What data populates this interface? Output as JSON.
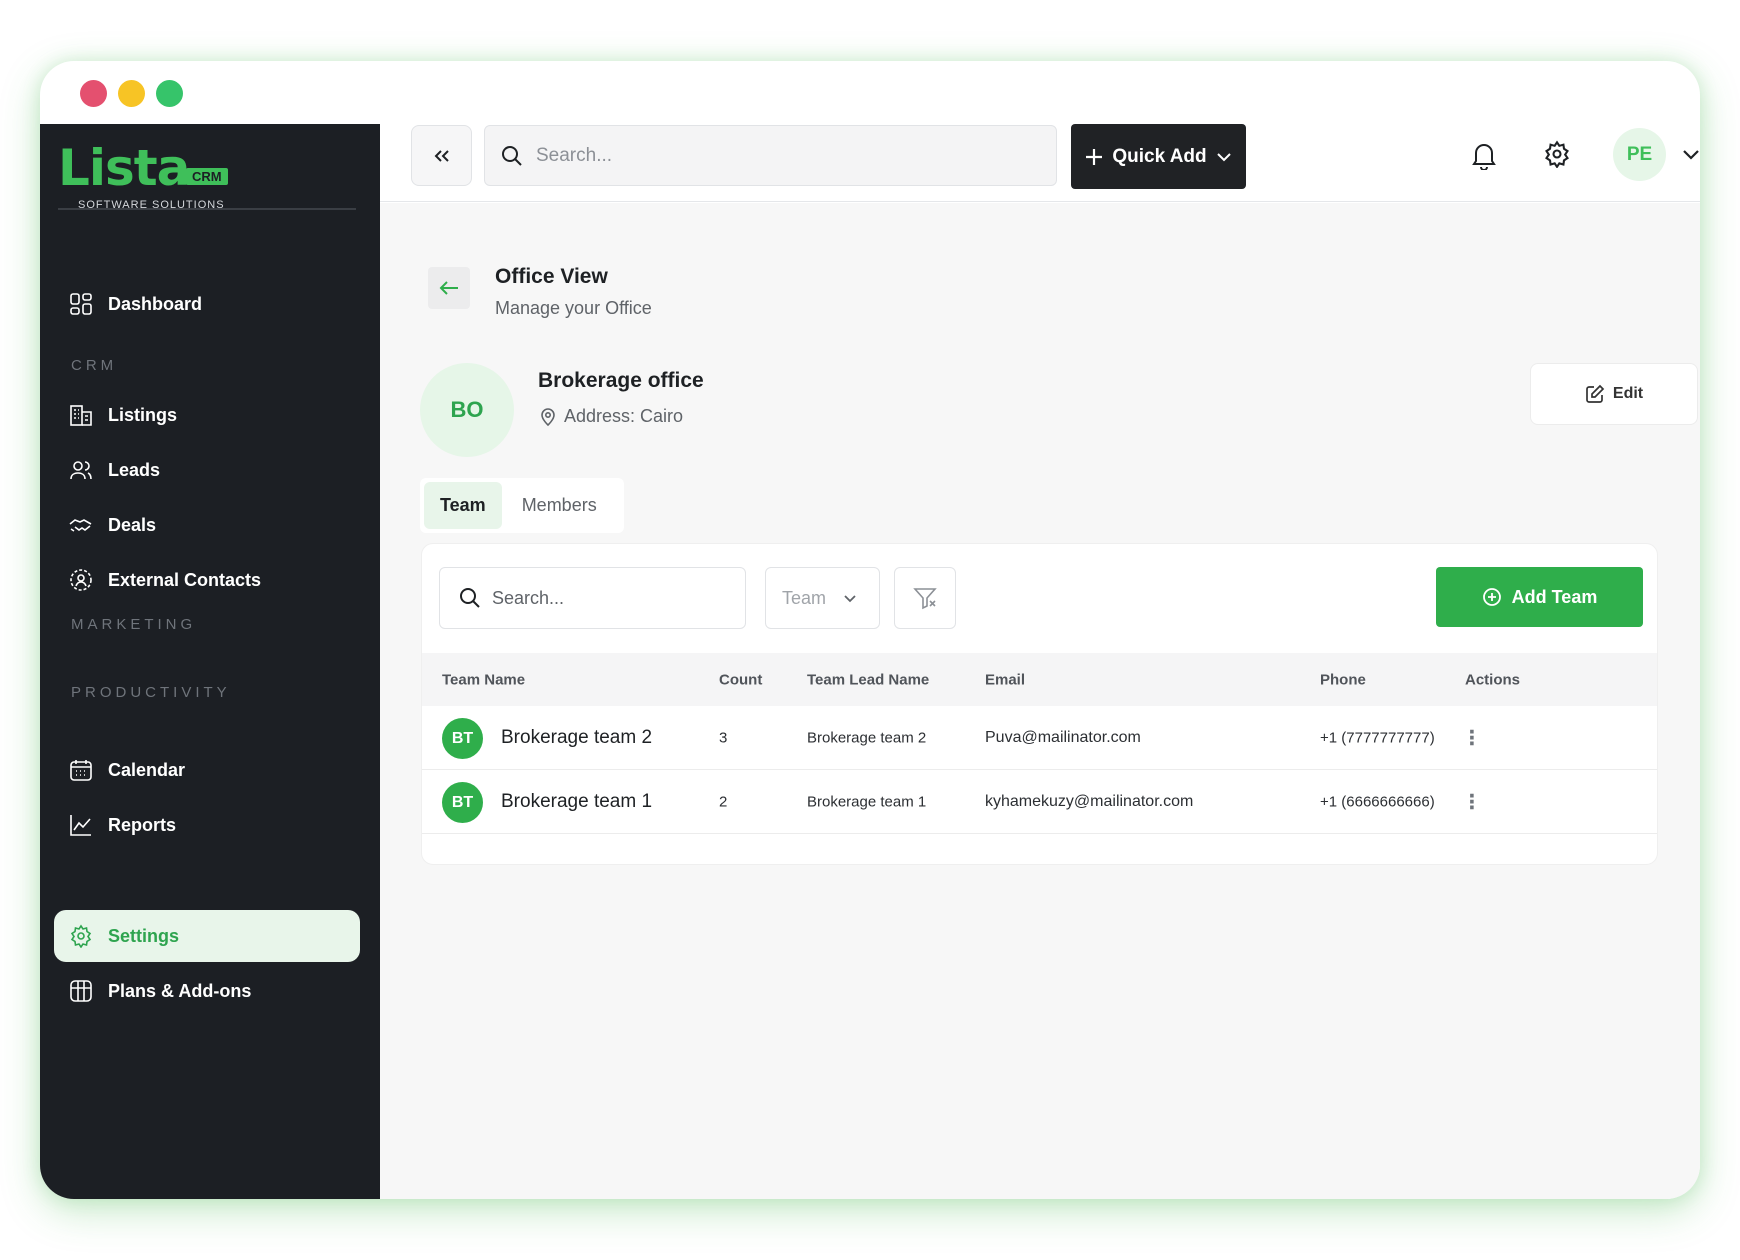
{
  "window": {
    "traffic": [
      "close",
      "minimize",
      "maximize"
    ]
  },
  "logo": {
    "word": "Lista",
    "badge": "CRM",
    "tagline": "SOFTWARE SOLUTIONS"
  },
  "sidebar": {
    "dashboard": "Dashboard",
    "section_crm": "CRM",
    "listings": "Listings",
    "leads": "Leads",
    "deals": "Deals",
    "external_contacts": "External Contacts",
    "section_marketing": "MARKETING",
    "section_productivity": "PRODUCTIVITY",
    "calendar": "Calendar",
    "reports": "Reports",
    "settings": "Settings",
    "plans": "Plans & Add-ons"
  },
  "topbar": {
    "search_placeholder": "Search...",
    "quick_add": "Quick Add",
    "user_initials": "PE"
  },
  "page": {
    "title": "Office View",
    "subtitle": "Manage your Office"
  },
  "office": {
    "initials": "BO",
    "name": "Brokerage office",
    "address": "Address: Cairo",
    "edit_label": "Edit"
  },
  "tabs": {
    "team": "Team",
    "members": "Members",
    "active": "Team"
  },
  "toolbar": {
    "search_placeholder": "Search...",
    "team_filter": "Team",
    "add_team": "Add Team"
  },
  "table": {
    "headers": {
      "name": "Team Name",
      "count": "Count",
      "lead": "Team Lead Name",
      "email": "Email",
      "phone": "Phone",
      "actions": "Actions"
    },
    "rows": [
      {
        "initials": "BT",
        "name": "Brokerage team 2",
        "count": "3",
        "lead": "Brokerage team 2",
        "email": "Puva@mailinator.com",
        "phone": "+1 (7777777777)"
      },
      {
        "initials": "BT",
        "name": "Brokerage team 1",
        "count": "2",
        "lead": "Brokerage team 1",
        "email": "kyhamekuzy@mailinator.com",
        "phone": "+1 (6666666666)"
      }
    ]
  },
  "colors": {
    "brand_green": "#3fbf5a",
    "button_green": "#2fae4b",
    "sidebar_bg": "#1c1f24",
    "active_bg": "#e8f5ea"
  }
}
